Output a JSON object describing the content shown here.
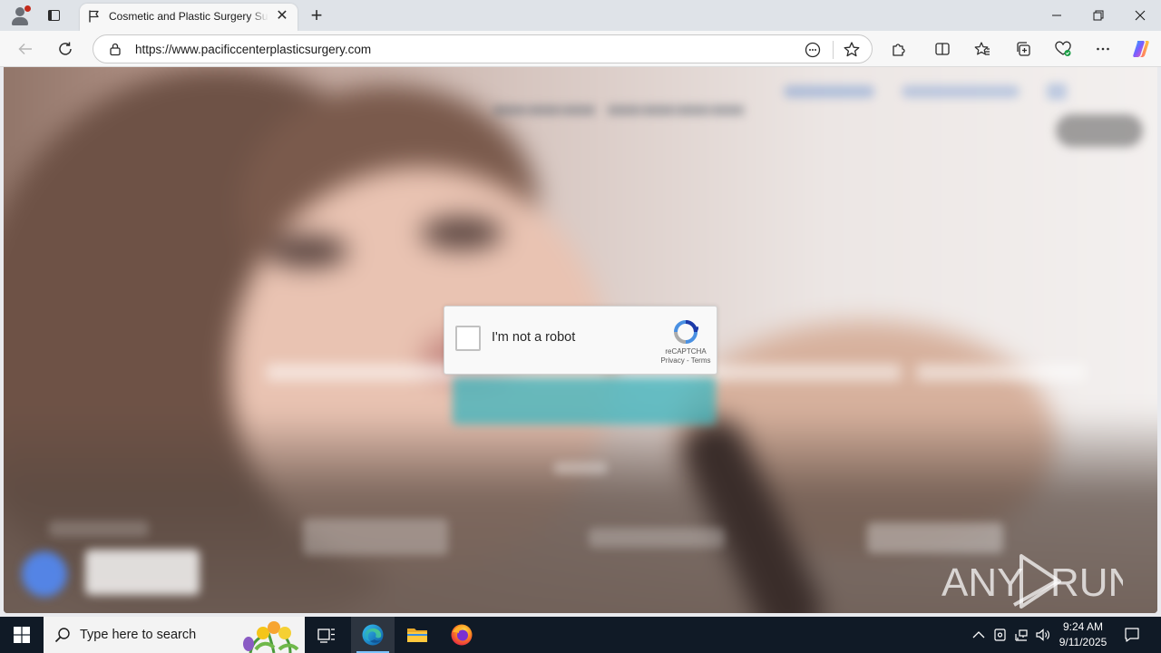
{
  "browser": {
    "tab": {
      "title": "Cosmetic and Plastic Surgery Surgeon",
      "close_glyph": "✕"
    },
    "new_tab_glyph": "+",
    "window_controls": {
      "minimize_glyph": "—",
      "restore_glyph": "❐",
      "close_glyph": "✕"
    },
    "address_bar": {
      "url": "https://www.pacificcenterplasticsurgery.com"
    }
  },
  "recaptcha": {
    "label": "I'm not a robot",
    "brand": "reCAPTCHA",
    "privacy": "Privacy",
    "separator": " - ",
    "terms": "Terms"
  },
  "watermark": {
    "left": "ANY",
    "right": "RUN"
  },
  "taskbar": {
    "search_placeholder": "Type here to search",
    "clock": {
      "time": "9:24 AM",
      "date": "9/11/2025"
    }
  },
  "icons": {
    "tab_favicon": "flag-icon",
    "back": "arrow-left-icon",
    "refresh": "refresh-icon",
    "site_info": "lock-icon",
    "favorite": "star-icon"
  },
  "colors": {
    "taskbar": "#101a26",
    "recaptcha_blue": "#1c3aa9",
    "recaptcha_accent": "#4a90e2",
    "edge_accent": "#0c8ce9"
  }
}
